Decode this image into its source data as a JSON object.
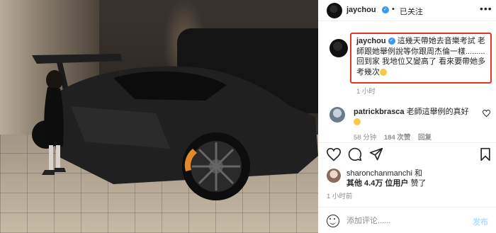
{
  "header": {
    "username": "jaychou",
    "separator": "•",
    "follow_status": "已关注",
    "more_label": "•••"
  },
  "caption": {
    "username": "jaychou",
    "text": "這幾天帶她去音樂考試 老師跟她舉例說等你跟周杰倫一樣.........回到家 我地位又變高了 看來要帶她多考幾次",
    "emoji": "smiling-face-emoji",
    "time": "1 小时"
  },
  "comment": {
    "username": "patrickbrasca",
    "text": "老師這舉例的真好",
    "emoji": "smiling-face-emoji",
    "time": "58 分钟",
    "likes": "184 次赞",
    "reply": "回复"
  },
  "likes": {
    "line1": "sharonchanmanchi 和",
    "line2_bold": "其他 4.4万 位用户",
    "line2_rest": " 赞了"
  },
  "post_time": "1 小时前",
  "comment_box": {
    "placeholder": "添加评论......",
    "post_label": "发布"
  },
  "icons": [
    "heart-icon",
    "comment-icon",
    "share-icon",
    "bookmark-icon",
    "smiley-icon",
    "verified-icon"
  ],
  "colors": {
    "highlight_border": "#e0352b",
    "verified": "#3897f0",
    "post_button": "#b2dffc"
  }
}
